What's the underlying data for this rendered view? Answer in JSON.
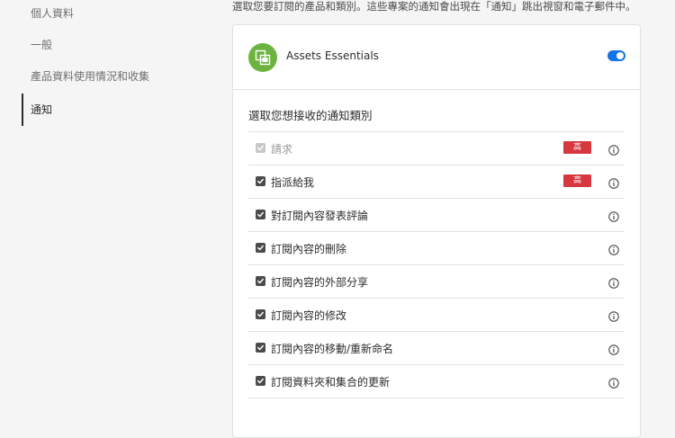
{
  "sidebar": {
    "items": [
      {
        "label": "個人資料"
      },
      {
        "label": "一般"
      },
      {
        "label": "產品資料使用情況和收集"
      },
      {
        "label": "通知",
        "active": true
      }
    ]
  },
  "intro_text": "選取您要訂閱的產品和類別。這些專案的通知會出現在「通知」跳出視窗和電子郵件中。",
  "card": {
    "app_name": "Assets Essentials",
    "app_icon": "assets-essentials-icon",
    "app_icon_color": "#6cb33f",
    "toggle_on": true,
    "toggle_color": "#1473e6",
    "section_title": "選取您想接收的通知類別",
    "categories": [
      {
        "label": "請求",
        "checked": true,
        "disabled": true,
        "badge": "高"
      },
      {
        "label": "指派給我",
        "checked": true,
        "disabled": false,
        "badge": "高"
      },
      {
        "label": "對訂閱內容發表評論",
        "checked": true,
        "disabled": false
      },
      {
        "label": "訂閱內容的刪除",
        "checked": true,
        "disabled": false
      },
      {
        "label": "訂閱內容的外部分享",
        "checked": true,
        "disabled": false
      },
      {
        "label": "訂閱內容的修改",
        "checked": true,
        "disabled": false
      },
      {
        "label": "訂閱內容的移動/重新命名",
        "checked": true,
        "disabled": false
      },
      {
        "label": "訂閱資料夾和集合的更新",
        "checked": true,
        "disabled": false
      }
    ],
    "badge_color": "#d7373f",
    "info_icon": "info-icon"
  }
}
